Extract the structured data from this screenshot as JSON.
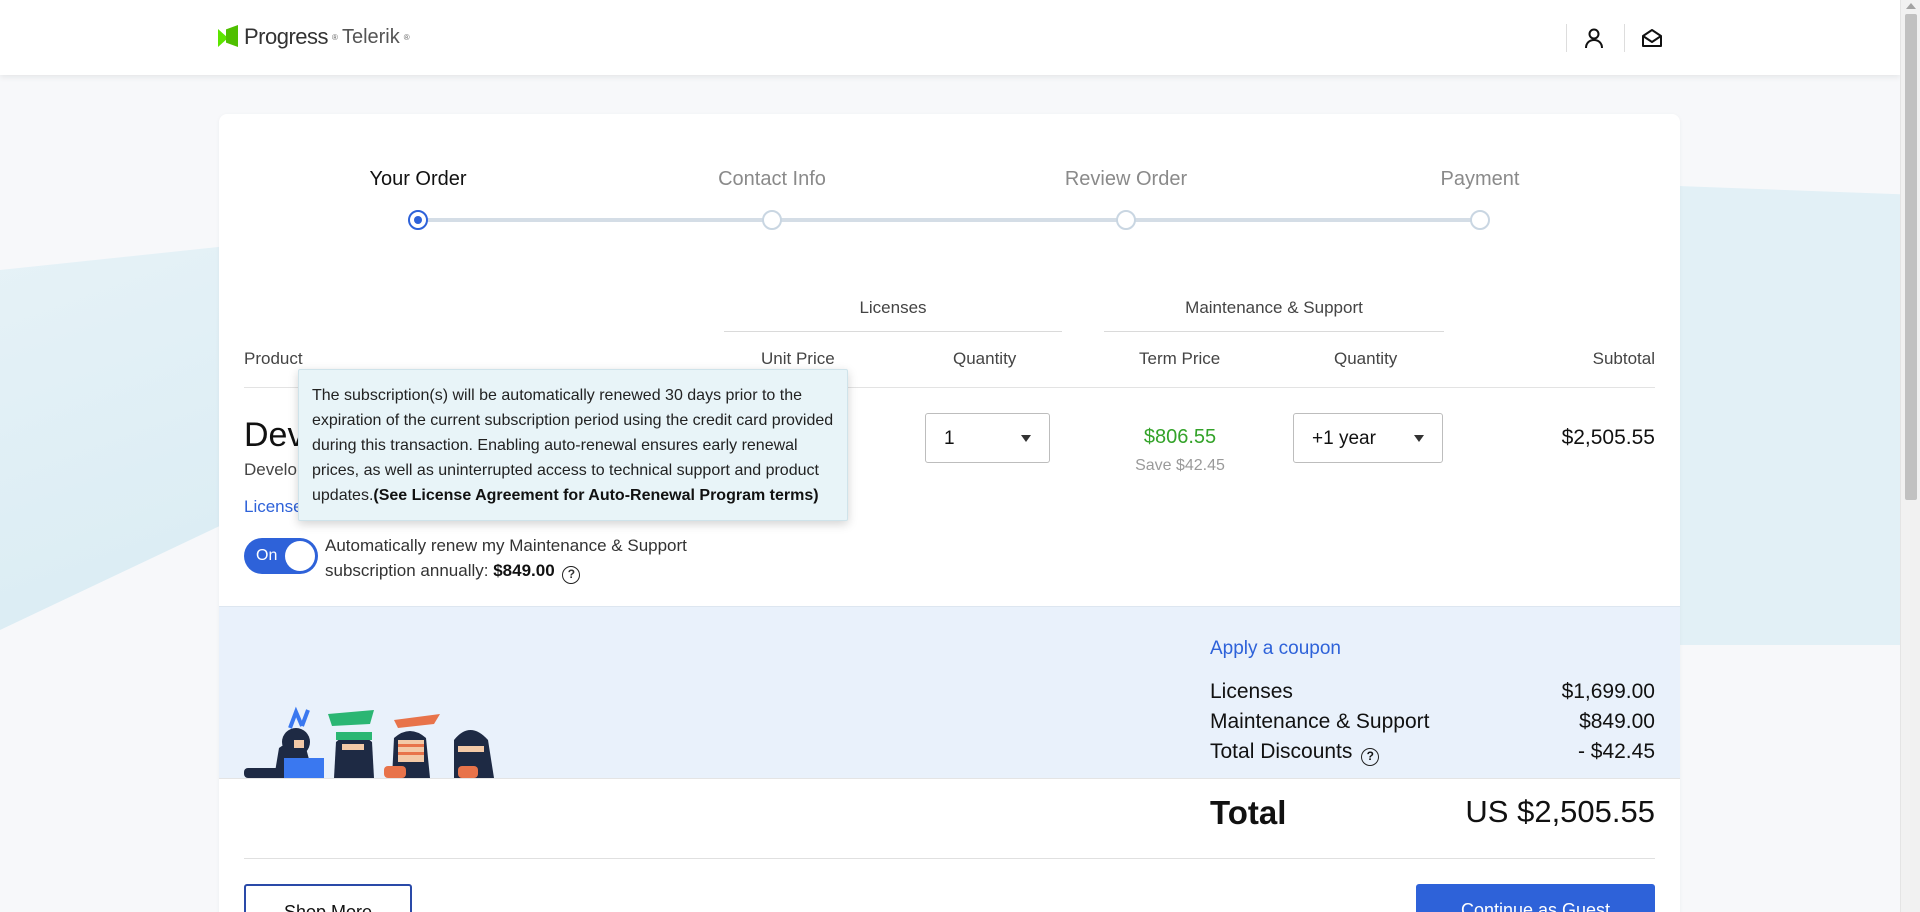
{
  "header": {
    "brand_progress": "Progress",
    "brand_telerik": "Telerik",
    "icons": [
      "user-icon",
      "mail-icon"
    ]
  },
  "stepper": {
    "steps": [
      "Your Order",
      "Contact Info",
      "Review Order",
      "Payment"
    ],
    "active_index": 0
  },
  "table": {
    "group_licenses": "Licenses",
    "group_maintenance": "Maintenance & Support",
    "columns": {
      "product": "Product",
      "unit_price": "Unit Price",
      "quantity": "Quantity",
      "term_price": "Term Price",
      "quantity2": "Quantity",
      "subtotal": "Subtotal"
    },
    "row": {
      "product_name": "Dev",
      "product_sub": "Develo",
      "license_link": "License",
      "license_qty": "1",
      "term_price": "$806.55",
      "term_save": "Save $42.45",
      "maint_qty": "+1 year",
      "subtotal": "$2,505.55"
    }
  },
  "auto_renew": {
    "toggle_label": "On",
    "text_line1": "Automatically renew my Maintenance & Support",
    "text_line2": "subscription annually: ",
    "amount": "$849.00"
  },
  "tooltip": {
    "text": "The subscription(s) will be automatically renewed 30 days prior to the expiration of the current subscription period using the credit card provided during this transaction. Enabling auto-renewal ensures early renewal prices, as well as uninterrupted access to technical support and product updates.",
    "bold": "(See License Agreement for Auto-Renewal Program terms)"
  },
  "summary": {
    "coupon": "Apply a coupon",
    "licenses_label": "Licenses",
    "licenses_value": "$1,699.00",
    "maintenance_label": "Maintenance & Support",
    "maintenance_value": "$849.00",
    "discounts_label": "Total Discounts",
    "discounts_value": "- $42.45",
    "total_label": "Total",
    "total_value": "US $2,505.55"
  },
  "buttons": {
    "shop_more": "Shop More",
    "continue_guest": "Continue as Guest"
  },
  "colors": {
    "accent": "#2e62d9",
    "price_green": "#34a32a",
    "summary_bg": "#e9f1fb",
    "tooltip_bg": "#e8f4f8"
  }
}
